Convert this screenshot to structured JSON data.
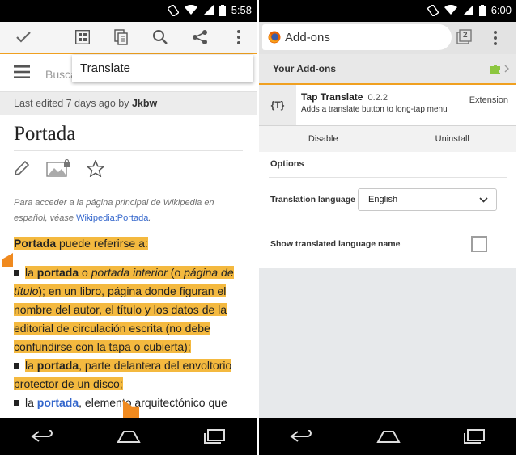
{
  "left": {
    "status": {
      "time": "5:58"
    },
    "toolbar": {
      "check_icon": "check-icon",
      "translate_icon": "apps-grid-icon",
      "copy_icon": "copy-icon",
      "search_icon": "search-icon",
      "share_icon": "share-icon",
      "more_icon": "more-vert-icon"
    },
    "header": {
      "search_placeholder": "Busca"
    },
    "popup": {
      "label": "Translate"
    },
    "edited": {
      "prefix": "Last edited 7 days ago by ",
      "user": "Jkbw"
    },
    "title": "Portada",
    "note": {
      "text": "Para acceder a la página principal de Wikipedia en español, véase ",
      "link": "Wikipedia:Portada",
      "suffix": "."
    },
    "body": {
      "p1_bold": "Portada",
      "p1_rest": " puede referirse a:",
      "item1_a": "la ",
      "item1_b": "portada",
      "item1_c": " o ",
      "item1_d": "portada interior",
      "item1_e": " (o ",
      "item1_f": "página de título",
      "item1_g": "); en un libro, página donde figuran el nombre del autor, el título y los datos de la editorial de circulación escrita (no debe confundirse con la tapa o cubierta);",
      "item2_a": "la ",
      "item2_b": "portada",
      "item2_c": ", parte delantera del envoltorio protector de un disco;",
      "item3_a": "la ",
      "item3_b": "portada",
      "item3_c": ", elemento arquitectónico que"
    }
  },
  "right": {
    "status": {
      "time": "6:00"
    },
    "toolbar": {
      "url_label": "Add-ons",
      "tabs_count": "2"
    },
    "section_title": "Your Add-ons",
    "addon": {
      "icon_text": "{T}",
      "name": "Tap Translate",
      "version": "0.2.2",
      "description": "Adds a translate button to long-tap menu",
      "type": "Extension"
    },
    "buttons": {
      "disable": "Disable",
      "uninstall": "Uninstall"
    },
    "options": {
      "title": "Options",
      "language_label": "Translation language",
      "language_value": "English",
      "show_label": "Show translated language name",
      "show_checked": false
    }
  },
  "colors": {
    "accent": "#f0a020",
    "highlight": "#f4b93f",
    "link": "#3366cc"
  }
}
